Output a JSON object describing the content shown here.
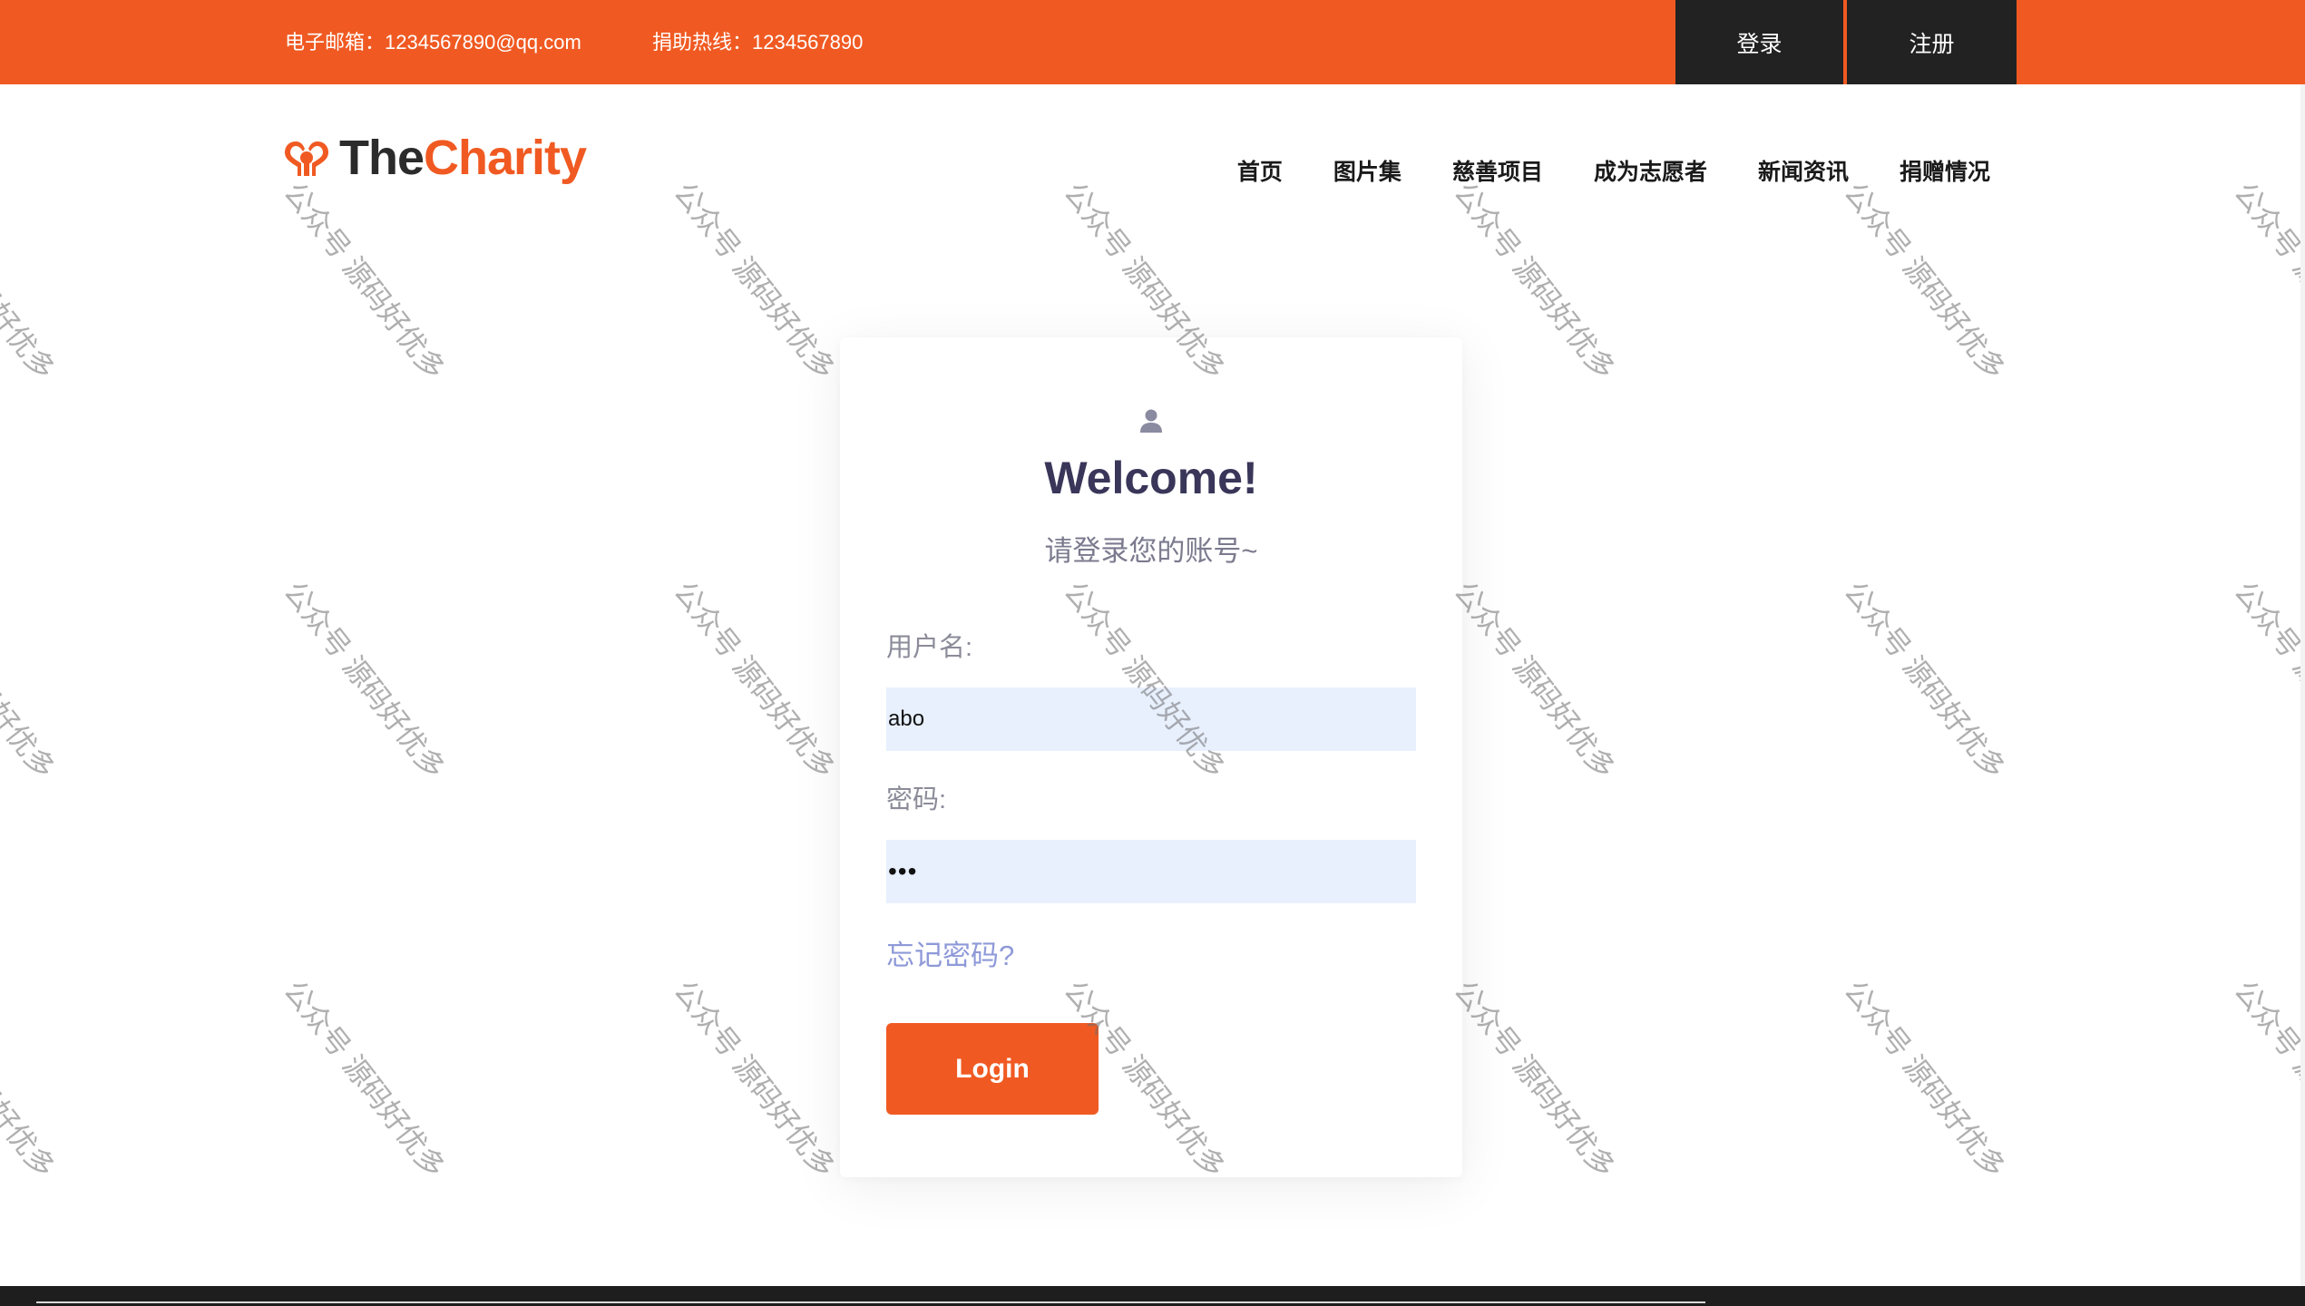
{
  "topbar": {
    "email": "电子邮箱：1234567890@qq.com",
    "phone": "捐助热线：1234567890",
    "login": "登录",
    "register": "注册",
    "color": "#f05a22"
  },
  "logo": {
    "part1": "The",
    "part2": "Charity",
    "icon": "heart-logo-icon"
  },
  "nav": {
    "items": [
      "首页",
      "图片集",
      "慈善项目",
      "成为志愿者",
      "新闻资讯",
      "捐赠情况"
    ]
  },
  "login_card": {
    "icon": "user-icon",
    "title": "Welcome!",
    "subtitle": "请登录您的账号~",
    "username_label": "用户名:",
    "username_value": "abo",
    "password_label": "密码:",
    "password_value": "•••",
    "forgot": "忘记密码?",
    "submit": "Login"
  },
  "watermark": {
    "text": "公众号 源码好优多"
  }
}
